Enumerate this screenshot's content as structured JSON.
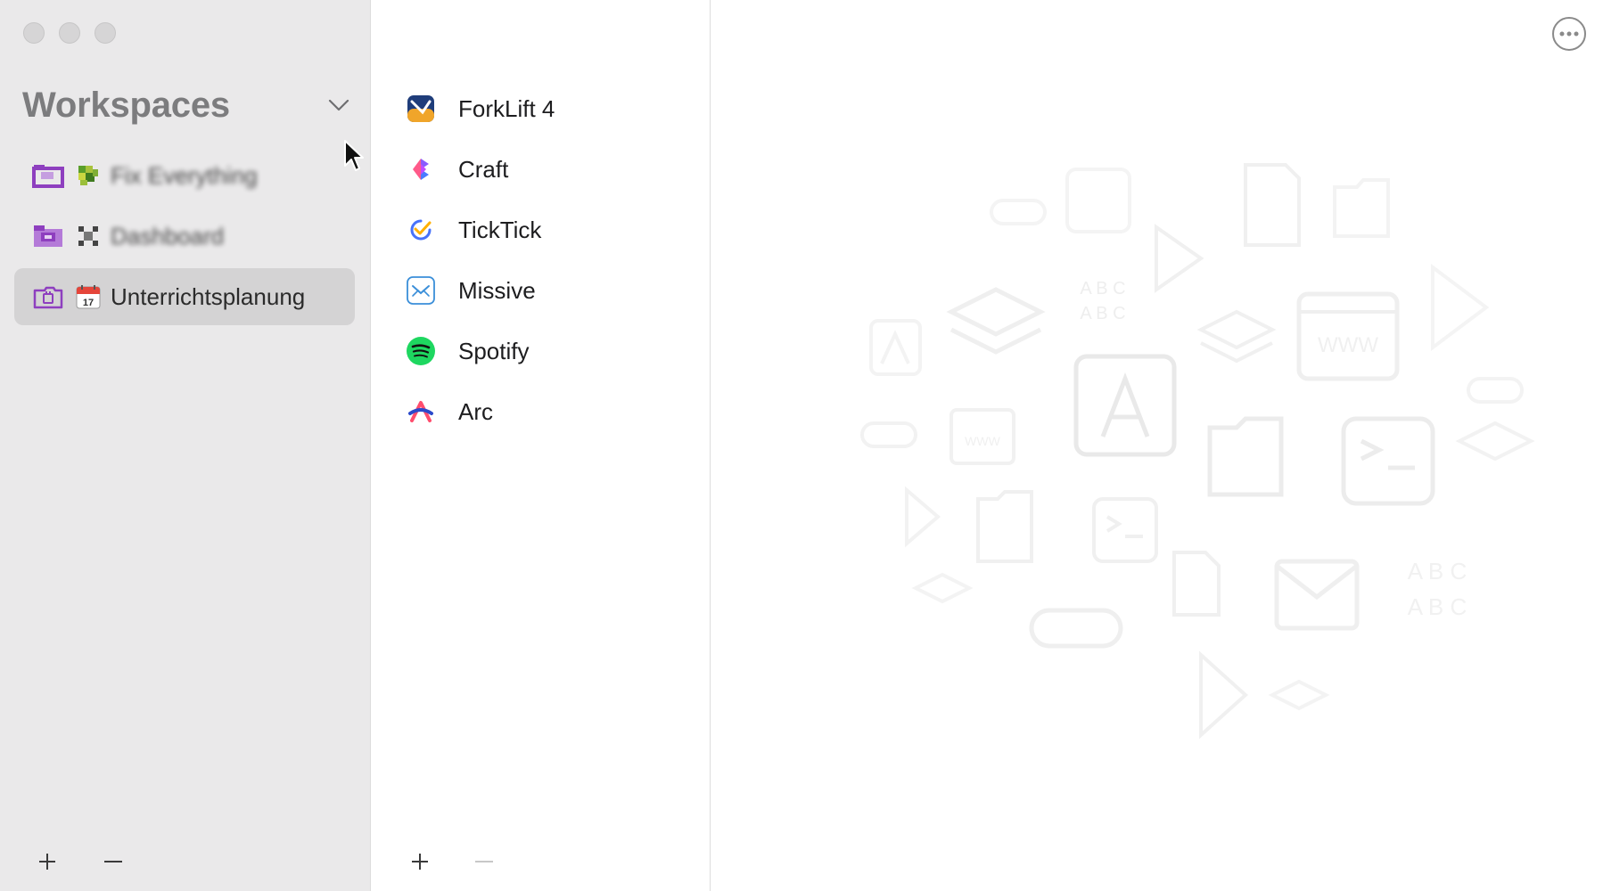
{
  "window": {
    "controls": [
      "close",
      "minimize",
      "zoom"
    ]
  },
  "sidebar": {
    "title": "Workspaces",
    "chevron_icon": "chevron-down-icon",
    "workspaces": [
      {
        "label": "Fix Everything",
        "emoji": "green-pixel-emoji",
        "selected": false,
        "blurred": true
      },
      {
        "label": "Dashboard",
        "emoji": "cross-emoji",
        "selected": false,
        "blurred": true
      },
      {
        "label": "Unterrichtsplanung",
        "emoji": "calendar-17-emoji",
        "selected": true,
        "blurred": false
      }
    ],
    "footer": {
      "add_icon": "plus-icon",
      "remove_icon": "minus-icon"
    }
  },
  "apps": {
    "items": [
      {
        "label": "ForkLift 4",
        "icon": "forklift-app-icon"
      },
      {
        "label": "Craft",
        "icon": "craft-app-icon"
      },
      {
        "label": "TickTick",
        "icon": "ticktick-app-icon"
      },
      {
        "label": "Missive",
        "icon": "missive-app-icon"
      },
      {
        "label": "Spotify",
        "icon": "spotify-app-icon"
      },
      {
        "label": "Arc",
        "icon": "arc-app-icon"
      }
    ],
    "footer": {
      "add_icon": "plus-icon",
      "remove_icon": "minus-icon",
      "remove_enabled": false
    }
  },
  "detail": {
    "more_icon": "more-ellipsis-icon"
  },
  "colors": {
    "sidebar_bg": "#eae9ea",
    "selected_bg": "#d4d3d4",
    "workspace_folder": "#8e3fbf",
    "spotify_green": "#1ed760"
  }
}
